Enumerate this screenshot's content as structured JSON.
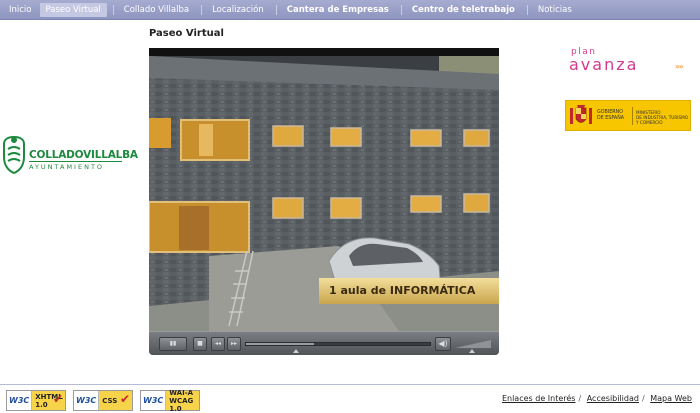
{
  "nav": {
    "items": [
      {
        "label": "Inicio",
        "bold": false,
        "active": false
      },
      {
        "label": "Paseo Virtual",
        "bold": false,
        "active": true
      },
      {
        "label": "Collado Villalba",
        "bold": false,
        "active": false
      },
      {
        "label": "Localización",
        "bold": false,
        "active": false
      },
      {
        "label": "Cantera de Empresas",
        "bold": true,
        "active": false
      },
      {
        "label": "Centro de teletrabajo",
        "bold": true,
        "active": false
      },
      {
        "label": "Noticias",
        "bold": false,
        "active": false
      }
    ]
  },
  "page": {
    "title": "Paseo Virtual"
  },
  "logos": {
    "collado": {
      "name": "COLLADOVILLALBA",
      "sub": "AYUNTAMIENTO"
    },
    "plan": {
      "top": "plan",
      "main": "avanza",
      "arrows": "»»"
    },
    "gobierno": {
      "line1": "GOBIERNO",
      "line2": "DE ESPAÑA",
      "min1": "MINISTERIO",
      "min2": "DE INDUSTRIA, TURISMO",
      "min3": "Y COMERCIO"
    }
  },
  "video": {
    "caption": "1 aula de INFORMÁTICA",
    "progress": 0.37,
    "controls": {
      "play": "▮▮",
      "stop": "■",
      "rewind": "◂◂",
      "forward": "▸▸",
      "volume": "◀)"
    }
  },
  "footer": {
    "badges": [
      {
        "w3c": "W3C",
        "line1": "XHTML",
        "line2": "1.0"
      },
      {
        "w3c": "W3C",
        "line1": "CSS",
        "line2": ""
      },
      {
        "w3c": "W3C",
        "line1": "WAI-A",
        "line2": "WCAG 1.0"
      }
    ],
    "links": [
      "Enlaces de Interés",
      "Accesibilidad",
      "Mapa Web"
    ]
  },
  "colors": {
    "nav_bg": "#979ec6",
    "brand_green": "#1d8a3e",
    "avanza_pink": "#d43a8e",
    "gobierno_yellow": "#f7c600"
  }
}
